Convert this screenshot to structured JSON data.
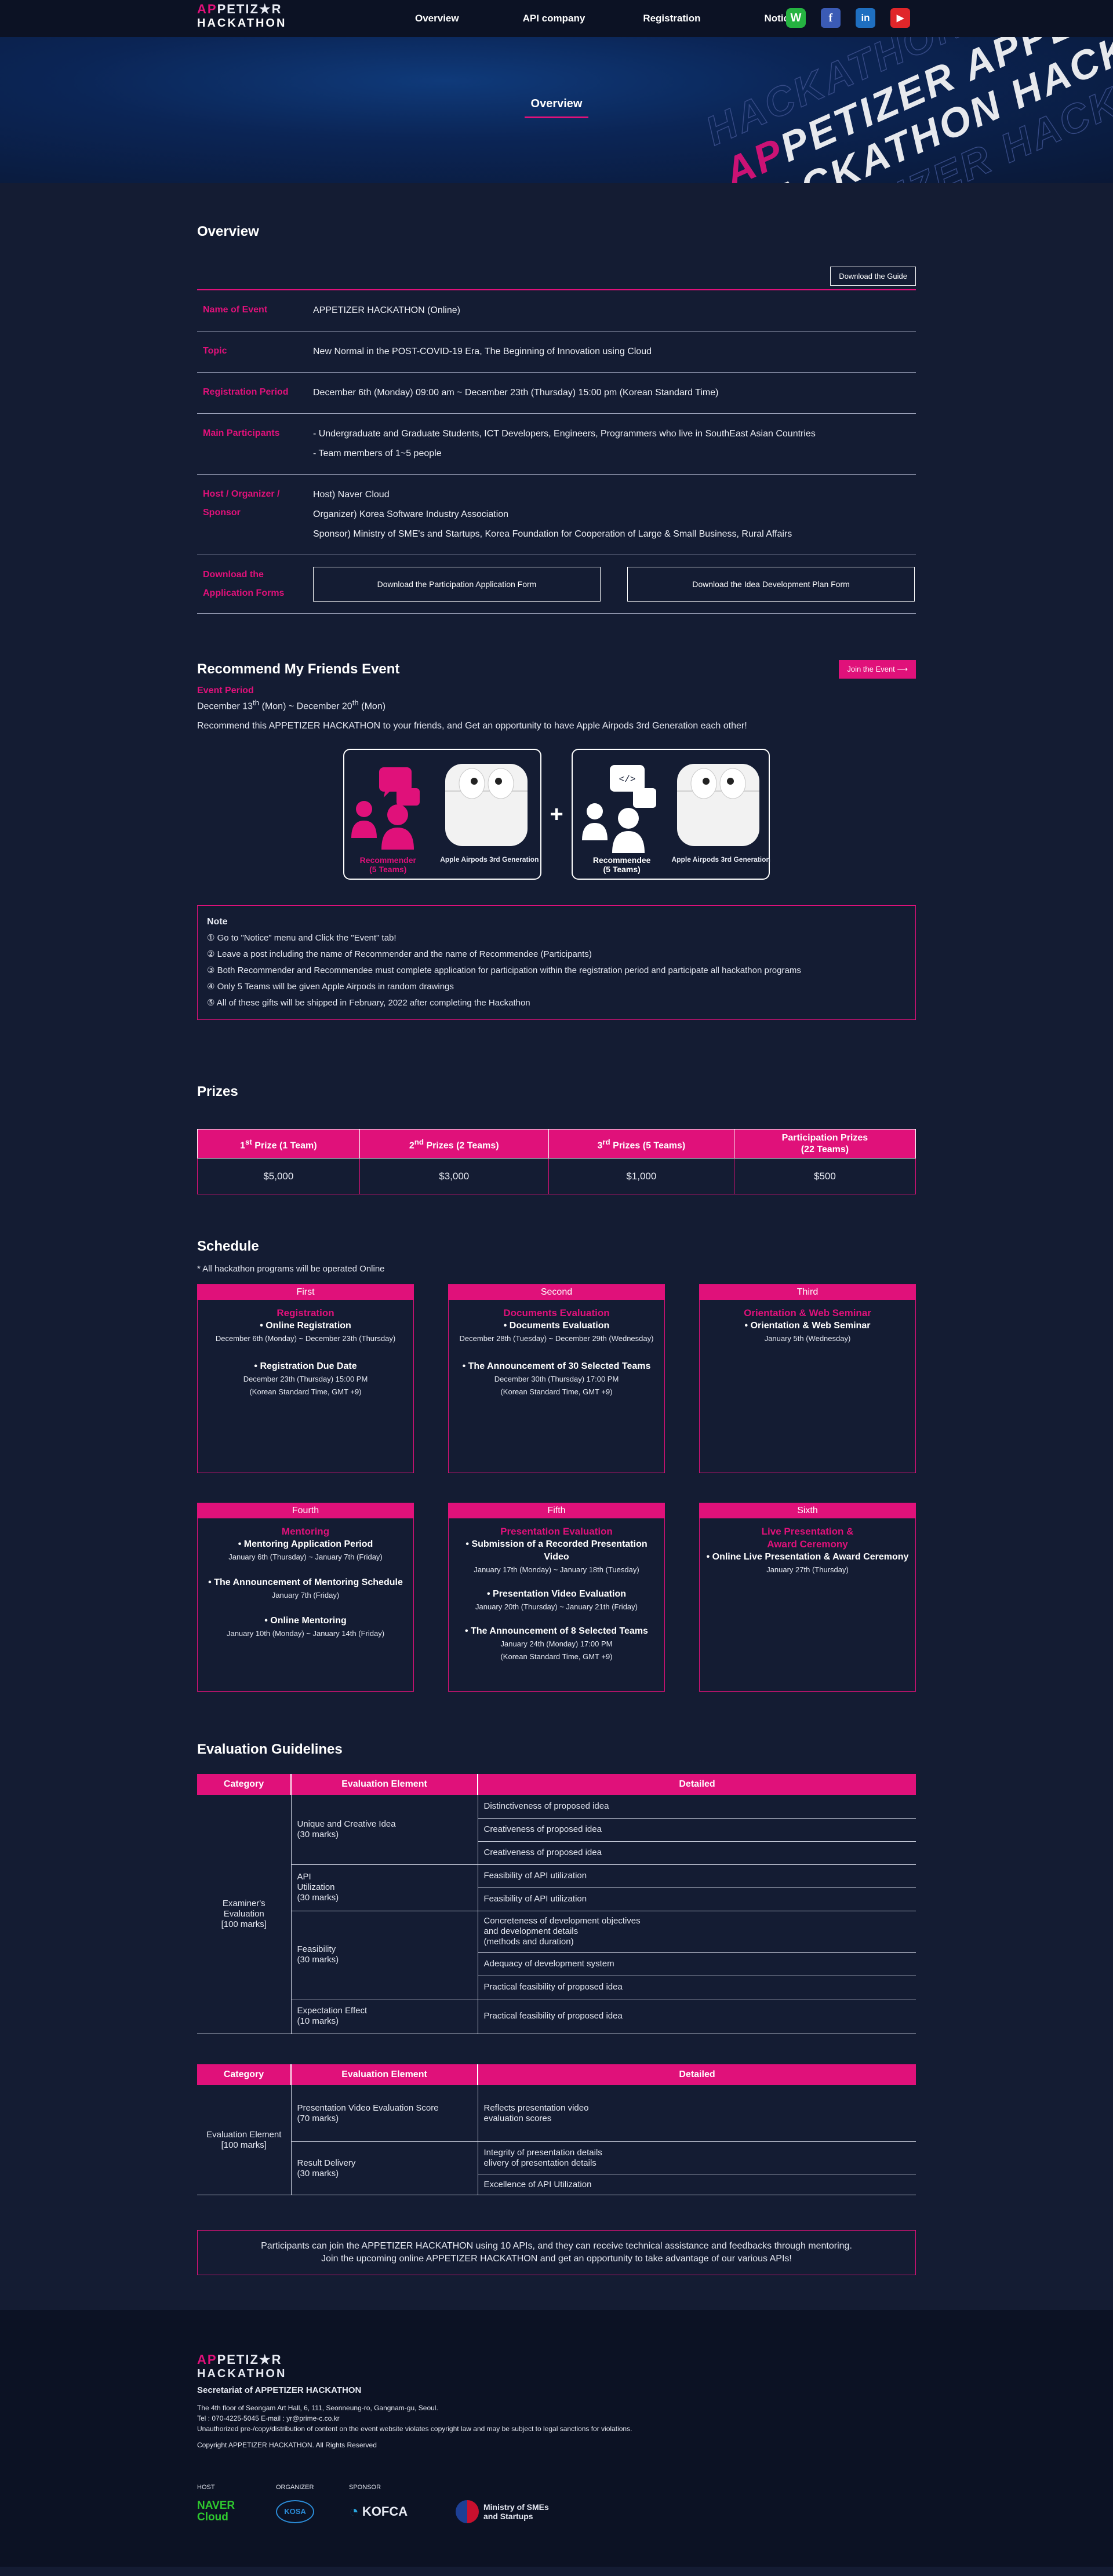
{
  "brand": {
    "logo_line1_a": "AP",
    "logo_line1_b": "PETIZ★R",
    "logo_line2": "HACKATHON"
  },
  "nav": {
    "items": [
      "Overview",
      "API company",
      "Registration",
      "Notice"
    ]
  },
  "social": {
    "whatsapp": "W",
    "facebook": "f",
    "linkedin": "in",
    "youtube": "▶"
  },
  "hero": {
    "title": "Overview"
  },
  "overview": {
    "heading": "Overview",
    "guide_button": "Download the Guide",
    "rows": [
      {
        "key": "Name of Event",
        "lines": [
          "APPETIZER HACKATHON (Online)"
        ]
      },
      {
        "key": "Topic",
        "lines": [
          "New Normal in the POST-COVID-19 Era, The Beginning of Innovation using Cloud"
        ]
      },
      {
        "key": "Registration Period",
        "lines": [
          "December 6th (Monday) 09:00 am ~ December 23th (Thursday) 15:00 pm (Korean Standard Time)"
        ]
      },
      {
        "key": "Main Participants",
        "lines": [
          "- Undergraduate and Graduate Students, ICT Developers, Engineers, Programmers who live in SouthEast Asian Countries",
          "- Team members of 1~5 people"
        ]
      },
      {
        "key": "Host / Organizer / Sponsor",
        "lines": [
          "Host) Naver Cloud",
          "Organizer) Korea Software Industry Association",
          "Sponsor) Ministry of SME's and Startups, Korea Foundation for Cooperation of Large & Small Business, Rural Affairs"
        ]
      }
    ],
    "forms_key": "Download the Application Forms",
    "form_btn_1": "Download the Participation Application Form",
    "form_btn_2": "Download the Idea Development Plan Form"
  },
  "recommend": {
    "heading": "Recommend My Friends Event",
    "join_button": "Join the Event",
    "period_label": "Event Period",
    "period_a": "December 13",
    "period_sup": "th",
    "period_b": " (Mon) ~ December 20",
    "period_c": " (Mon)",
    "desc": "Recommend this APPETIZER HACKATHON to your friends, and Get an opportunity to have Apple Airpods 3rd Generation each other!",
    "card1_label": "Recommender",
    "card1_sub": "(5 Teams)",
    "card2_label": "Recommendee",
    "card2_sub": "(5 Teams)",
    "airpods": "Apple Airpods 3rd Generation",
    "plus": "+",
    "note_title": "Note",
    "notes": [
      "① Go to \"Notice\" menu and Click the \"Event\" tab!",
      "② Leave a post including the name of Recommender and the name of Recommendee (Participants)",
      "③ Both Recommender and Recommendee must complete application for participation within the registration period and participate all hackathon programs",
      "④ Only 5 Teams will be given Apple Airpods in random drawings",
      "⑤ All of these gifts will be shipped in February, 2022 after completing the Hackathon"
    ]
  },
  "prizes": {
    "heading": "Prizes",
    "headers": [
      {
        "n": "1",
        "sup": "st",
        "rest": " Prize (1 Team)"
      },
      {
        "n": "2",
        "sup": "nd",
        "rest": " Prizes (2 Teams)"
      },
      {
        "n": "3",
        "sup": "rd",
        "rest": " Prizes (5 Teams)"
      },
      {
        "n": "Participation Prizes",
        "sup": "",
        "rest": "(22 Teams)"
      }
    ],
    "values": [
      "$5,000",
      "$3,000",
      "$1,000",
      "$500"
    ]
  },
  "schedule": {
    "heading": "Schedule",
    "note": "* All hackathon programs will be operated Online",
    "first": {
      "h": "First",
      "t": "Registration",
      "b1": "• Online Registration",
      "s1": "December 6th (Monday) ~ December 23th (Thursday)",
      "b2": "• Registration Due Date",
      "s2": "December 23th (Thursday) 15:00 PM",
      "s3": "(Korean Standard Time, GMT +9)"
    },
    "second": {
      "h": "Second",
      "t": "Documents Evaluation",
      "b1": "• Documents Evaluation",
      "s1": "December 28th (Tuesday) ~ December 29th (Wednesday)",
      "b2": "• The Announcement of 30 Selected Teams",
      "s2": "December 30th (Thursday) 17:00 PM",
      "s3": "(Korean Standard Time, GMT +9)"
    },
    "third": {
      "h": "Third",
      "t": "Orientation & Web Seminar",
      "b1": "• Orientation & Web Seminar",
      "s1": "January 5th (Wednesday)"
    },
    "fourth": {
      "h": "Fourth",
      "t": "Mentoring",
      "b1": "• Mentoring Application Period",
      "s1": "January 6th (Thursday) ~ January 7th (Friday)",
      "b2": "• The Announcement of Mentoring Schedule",
      "s2": "January 7th (Friday)",
      "b3": "• Online Mentoring",
      "s3": "January 10th (Monday) ~ January 14th (Friday)"
    },
    "fifth": {
      "h": "Fifth",
      "t": "Presentation Evaluation",
      "b1": "• Submission of a Recorded Presentation Video",
      "s1": "January 17th (Monday) ~ January 18th (Tuesday)",
      "b2": "• Presentation Video Evaluation",
      "s2": "January 20th (Thursday) ~ January 21th (Friday)",
      "b3": "• The Announcement of 8 Selected Teams",
      "s3": "January 24th (Monday) 17:00 PM",
      "s4": "(Korean Standard Time, GMT +9)"
    },
    "sixth": {
      "h": "Sixth",
      "t1": "Live Presentation &",
      "t2": "Award Ceremony",
      "b1": "• Online Live Presentation & Award Ceremony",
      "s1": "January 27th (Thursday)"
    }
  },
  "evaluation": {
    "heading": "Evaluation Guidelines",
    "col_category": "Category",
    "col_element": "Evaluation Element",
    "col_detailed": "Detailed",
    "t1_category_a": "Examiner's Evaluation",
    "t1_category_b": "[100 marks]",
    "t1_el1_a": "Unique and Creative Idea",
    "t1_el1_b": "(30 marks)",
    "t1_d1": "Distinctiveness of proposed idea",
    "t1_d2": "Creativeness of proposed idea",
    "t1_d3": "Creativeness of proposed idea",
    "t1_el2_a": "API",
    "t1_el2_b": "Utilization",
    "t1_el2_c": "(30 marks)",
    "t1_d4": "Feasibility of API utilization",
    "t1_d5": "Feasibility of API utilization",
    "t1_el3_a": "Feasibility",
    "t1_el3_b": "(30 marks)",
    "t1_d6_a": "Concreteness of development objectives",
    "t1_d6_b": "and development details",
    "t1_d6_c": "(methods and duration)",
    "t1_d7": "Adequacy of development system",
    "t1_d8": "Practical feasibility of proposed idea",
    "t1_el4_a": "Expectation Effect",
    "t1_el4_b": "(10 marks)",
    "t1_d9": "Practical feasibility of proposed idea",
    "t2_category_a": "Evaluation Element",
    "t2_category_b": "[100 marks]",
    "t2_el1_a": "Presentation Video Evaluation Score",
    "t2_el1_b": "(70 marks)",
    "t2_d1_a": "Reflects presentation video",
    "t2_d1_b": "evaluation scores",
    "t2_el2_a": "Result Delivery",
    "t2_el2_b": "(30 marks)",
    "t2_d2_a": "Integrity of presentation details",
    "t2_d2_b": "elivery of presentation details",
    "t2_d3": "Excellence of API Utilization",
    "info_a": "Participants can join the APPETIZER HACKATHON using 10 APIs, and they can receive technical assistance and feedbacks through mentoring.",
    "info_b": "Join the upcoming online APPETIZER HACKATHON and get an opportunity to take advantage of our various APIs!"
  },
  "footer": {
    "secretariat": "Secretariat of APPETIZER HACKATHON",
    "address": "The 4th floor of Seongam Art Hall, 6, 111, Seonneung-ro, Gangnam-gu, Seoul.",
    "contact": "Tel : 070-4225-5045 E-mail : yr@prime-c.co.kr",
    "legal": "Unauthorized pre-/copy/distribution of content on the event website violates copyright law and may be subject to legal sanctions for violations.",
    "copyright": "Copyright APPETIZER HACKATHON. All Rights Reserved",
    "host_label": "HOST",
    "organizer_label": "ORGANIZER",
    "sponsor_label": "SPONSOR",
    "naver_a": "NAVER",
    "naver_b": "Cloud",
    "kosa": "KOSA",
    "kofca": "KOFCA",
    "ministry_a": "Ministry of SMEs",
    "ministry_b": "and Startups"
  },
  "colors": {
    "accent": "#e0117a",
    "background": "#141c33",
    "footer": "#0c1224"
  }
}
